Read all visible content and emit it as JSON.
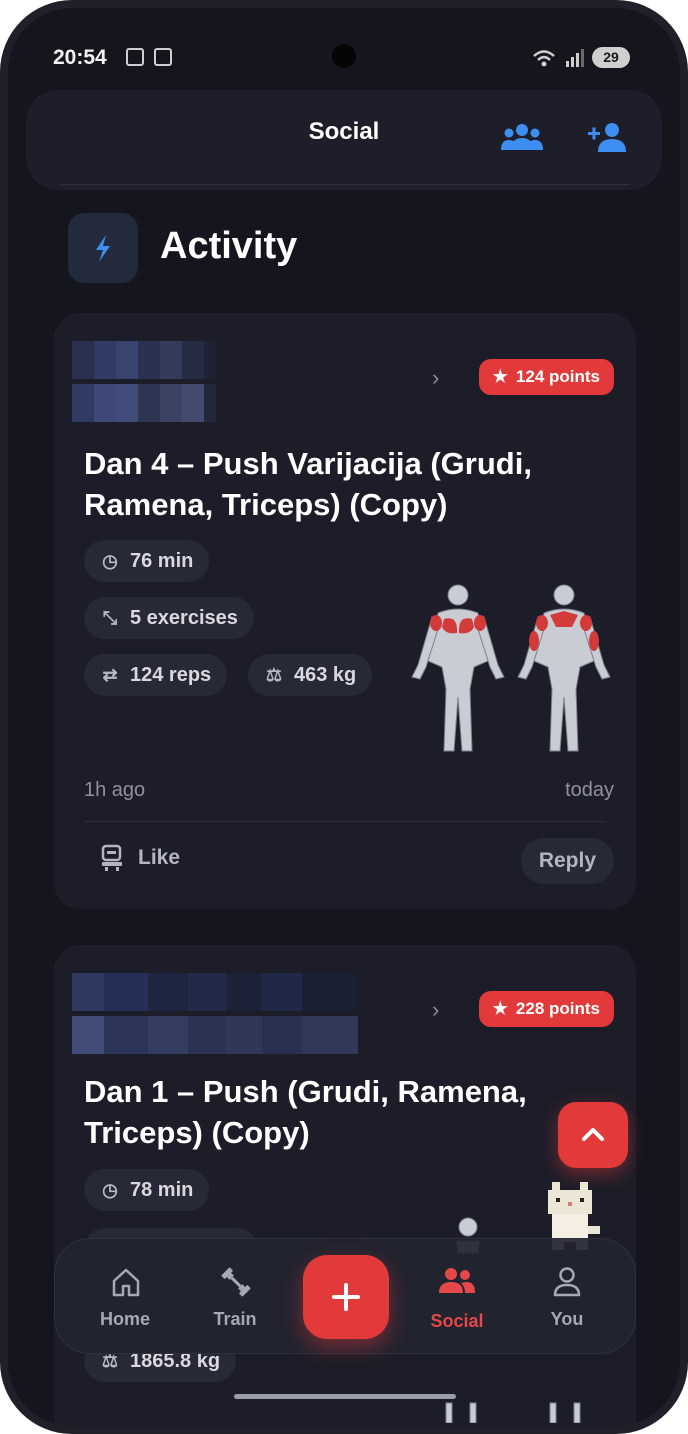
{
  "status_bar": {
    "time": "20:54",
    "battery": "29"
  },
  "header": {
    "title": "Social"
  },
  "section": {
    "title": "Activity"
  },
  "feed": [
    {
      "points": "124 points",
      "title": "Dan 4 – Push Varijacija (Grudi, Ramena, Triceps)  (Copy)",
      "duration": "76 min",
      "exercises": "5 exercises",
      "reps": "124 reps",
      "weight": "463 kg",
      "time_ago": "1h ago",
      "date": "today",
      "like_label": "Like",
      "reply_label": "Reply"
    },
    {
      "points": "228 points",
      "title": "Dan 1 – Push (Grudi, Ramena, Triceps) (Copy)",
      "duration": "78 min",
      "weight": "1865.8 kg"
    }
  ],
  "nav": {
    "home": "Home",
    "train": "Train",
    "social": "Social",
    "you": "You"
  },
  "colors": {
    "accent": "#e23a3a",
    "background": "#14151d",
    "card": "#1c1d28",
    "link_blue": "#3d8ef0"
  }
}
